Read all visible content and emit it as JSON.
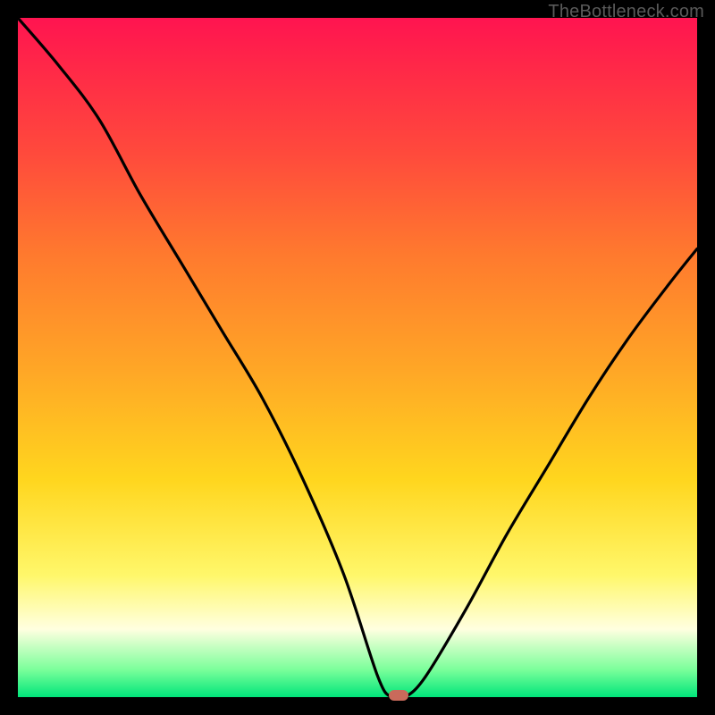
{
  "watermark": "TheBottleneck.com",
  "colors": {
    "frame": "#000000",
    "gradient_top": "#ff1450",
    "gradient_bottom": "#00e57a",
    "curve": "#000000",
    "marker": "#c96a5b"
  },
  "chart_data": {
    "type": "line",
    "title": "",
    "xlabel": "",
    "ylabel": "",
    "xlim": [
      0,
      100
    ],
    "ylim": [
      0,
      100
    ],
    "grid": false,
    "legend": false,
    "marker": {
      "x": 56,
      "y": 0
    },
    "series": [
      {
        "name": "bottleneck-curve",
        "x": [
          0,
          6,
          12,
          18,
          24,
          30,
          36,
          42,
          48,
          53,
          55,
          57,
          60,
          66,
          72,
          78,
          84,
          90,
          96,
          100
        ],
        "values": [
          100,
          93,
          85,
          74,
          64,
          54,
          44,
          32,
          18,
          3,
          0,
          0,
          3,
          13,
          24,
          34,
          44,
          53,
          61,
          66
        ]
      }
    ]
  }
}
